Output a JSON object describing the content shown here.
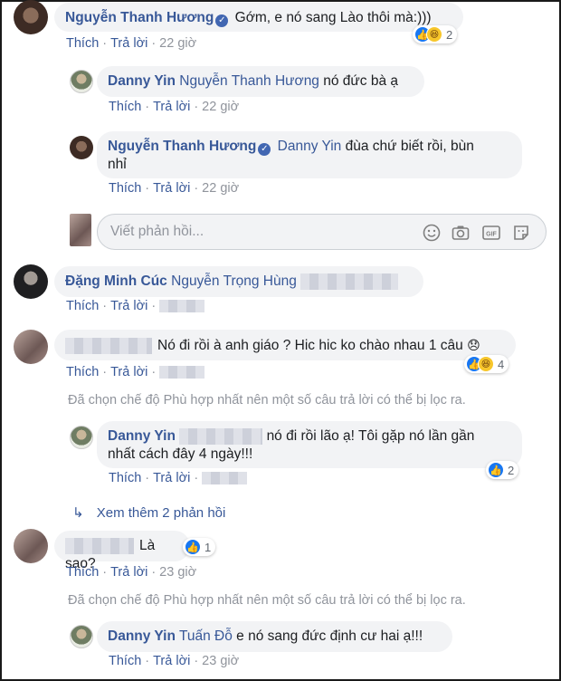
{
  "comments": [
    {
      "name": "Nguyễn Thanh Hương",
      "verified": true,
      "text": "Gớm, e nó sang Lào thôi mà:)))",
      "like": "Thích",
      "reply": "Trả lời",
      "time": "22 giờ",
      "reaction_count": "2"
    },
    {
      "name": "Danny Yin",
      "tag": "Nguyễn Thanh Hương",
      "text": "nó đức bà ạ",
      "like": "Thích",
      "reply": "Trả lời",
      "time": "22 giờ"
    },
    {
      "name": "Nguyễn Thanh Hương",
      "verified": true,
      "tag": "Danny Yin",
      "text_line1": "đùa chứ biết rồi, bùn",
      "text_line2": "nhỉ",
      "like": "Thích",
      "reply": "Trả lời",
      "time": "22 giờ"
    },
    {
      "name": "Đặng Minh Cúc",
      "tag": "Nguyễn Trọng Hùng",
      "like": "Thích",
      "reply": "Trả lời"
    },
    {
      "text": "Nó đi rồi à anh giáo ? Hic hic ko chào nhau 1 câu",
      "emoji": "😞",
      "like": "Thích",
      "reply": "Trả lời",
      "reaction_count": "4"
    },
    {
      "name": "Danny Yin",
      "text_line1": "nó đi rồi lão ạ! Tôi gặp nó lần gần",
      "text_line2": "nhất cách đây 4 ngày!!!",
      "like": "Thích",
      "reply": "Trả lời",
      "reaction_count": "2"
    },
    {
      "text": "Là sao?",
      "like": "Thích",
      "reply": "Trả lời",
      "time": "23 giờ",
      "reaction_count": "1"
    },
    {
      "name": "Danny Yin",
      "tag": "Tuấn Đỗ",
      "text": "e nó sang đức định cư hai ạ!!!",
      "like": "Thích",
      "reply": "Trả lời",
      "time": "23 giờ"
    }
  ],
  "reply_box": {
    "placeholder": "Viết phản hồi...",
    "icons": [
      "smiley-icon",
      "camera-icon",
      "gif-icon",
      "sticker-icon"
    ]
  },
  "filter_notice": "Đã chọn chế độ Phù hợp nhất nên một số câu trả lời có thể bị lọc ra.",
  "view_more": {
    "arrow": "↳",
    "label": "Xem thêm 2 phản hồi"
  },
  "colors": {
    "link": "#385898",
    "meta": "#90949c",
    "bubble": "#f2f3f5",
    "like_blue": "#1877f2"
  }
}
